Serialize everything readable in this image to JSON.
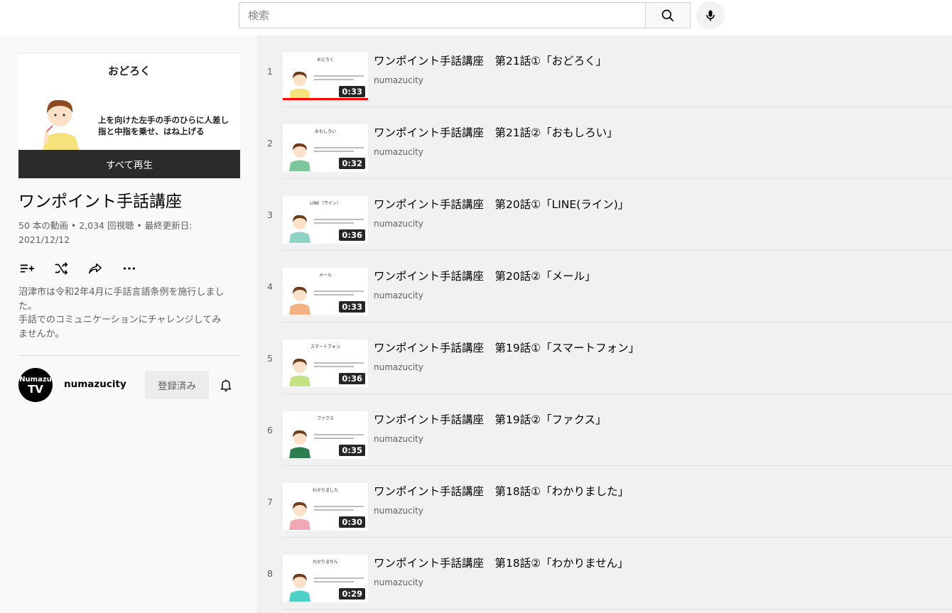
{
  "search": {
    "placeholder": "検索"
  },
  "icons": {
    "search": "search-icon",
    "mic": "microphone-icon",
    "add_to_queue": "add-to-queue-icon",
    "shuffle": "shuffle-icon",
    "share": "share-icon",
    "more": "more-icon",
    "bell": "bell-icon"
  },
  "hero": {
    "title": "おどろく",
    "text_line1": "上を向けた左手の手のひらに人差し",
    "text_line2": "指と中指を乗せ、はね上げる",
    "play_all": "すべて再生"
  },
  "playlist": {
    "title": "ワンポイント手話講座",
    "stats_line1": "50 本の動画 • 2,034 回視聴 • 最終更新日:",
    "stats_line2": "2021/12/12",
    "description_lines": [
      "沼津市は令和2年4月に手話言語条例を施行しまし",
      "た。",
      "手話でのコミュニケーションにチャレンジしてみ",
      "ませんか。"
    ]
  },
  "owner": {
    "avatar_top": "Numazu",
    "avatar_bottom": "TV",
    "name": "numazucity",
    "subscribed_label": "登録済み"
  },
  "videos": [
    {
      "index": "1",
      "title": "ワンポイント手話講座　第21話①「おどろく」",
      "channel": "numazucity",
      "duration": "0:33",
      "thumb_word": "おどろく",
      "shirt": "#f6e27a",
      "watched": 1.0
    },
    {
      "index": "2",
      "title": "ワンポイント手話講座　第21話②「おもしろい」",
      "channel": "numazucity",
      "duration": "0:32",
      "thumb_word": "おもしろい",
      "shirt": "#7fc79a",
      "watched": 0
    },
    {
      "index": "3",
      "title": "ワンポイント手話講座　第20話①「LINE(ライン)」",
      "channel": "numazucity",
      "duration": "0:36",
      "thumb_word": "LINE（ライン）",
      "shirt": "#8fd3c4",
      "watched": 0
    },
    {
      "index": "4",
      "title": "ワンポイント手話講座　第20話②「メール」",
      "channel": "numazucity",
      "duration": "0:33",
      "thumb_word": "メール",
      "shirt": "#f4b183",
      "watched": 0
    },
    {
      "index": "5",
      "title": "ワンポイント手話講座　第19話①「スマートフォン」",
      "channel": "numazucity",
      "duration": "0:36",
      "thumb_word": "スマートフォン",
      "shirt": "#c5e384",
      "watched": 0
    },
    {
      "index": "6",
      "title": "ワンポイント手話講座　第19話②「ファクス」",
      "channel": "numazucity",
      "duration": "0:35",
      "thumb_word": "ファクス",
      "shirt": "#2e7d4f",
      "watched": 0
    },
    {
      "index": "7",
      "title": "ワンポイント手話講座　第18話①「わかりました」",
      "channel": "numazucity",
      "duration": "0:30",
      "thumb_word": "わかりました",
      "shirt": "#f2a7b5",
      "watched": 0
    },
    {
      "index": "8",
      "title": "ワンポイント手話講座　第18話②「わかりません」",
      "channel": "numazucity",
      "duration": "0:29",
      "thumb_word": "わかりません",
      "shirt": "#4fd0c6",
      "watched": 0
    }
  ]
}
